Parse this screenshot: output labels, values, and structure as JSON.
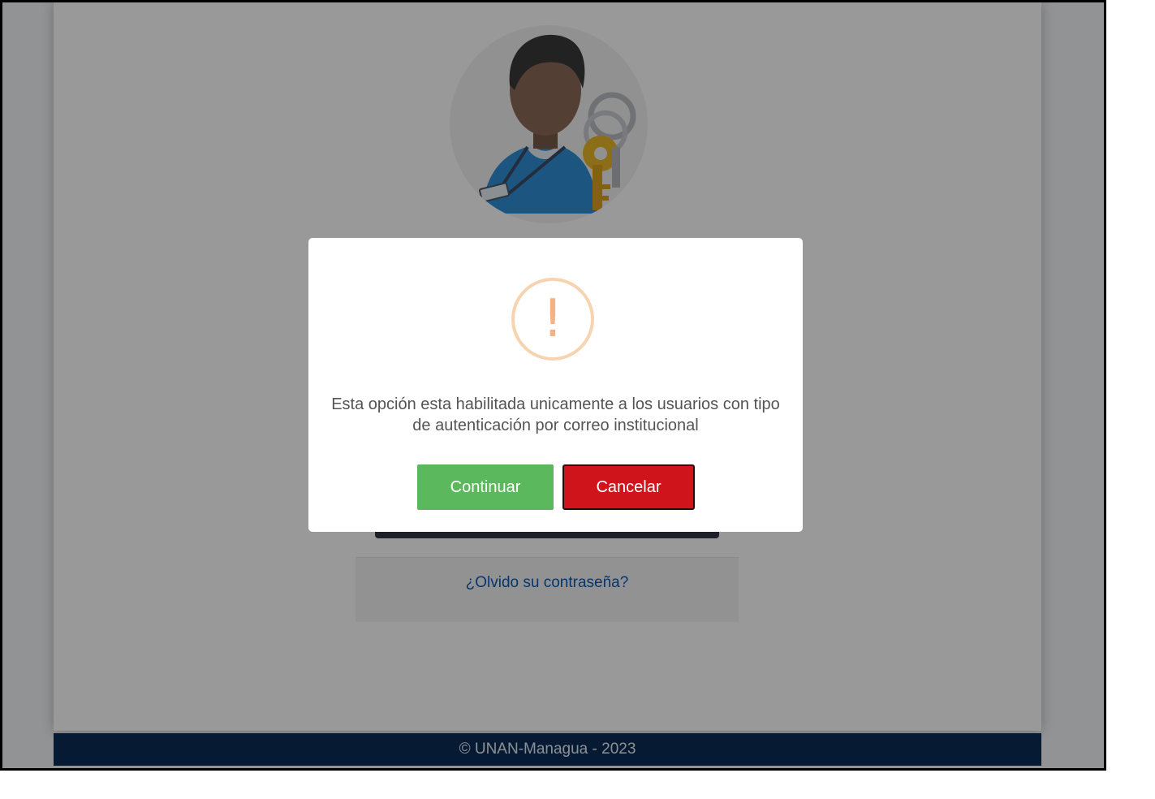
{
  "login_page": {
    "forgot_password_link": "¿Olvido su contraseña?",
    "footer_text": "© UNAN-Managua - 2023"
  },
  "modal": {
    "icon": "warning-exclamation-icon",
    "icon_glyph": "!",
    "message": "Esta opción esta habilitada unicamente a los usuarios con tipo de autenticación por correo institucional",
    "continue_label": "Continuar",
    "cancel_label": "Cancelar"
  },
  "colors": {
    "continue_button": "#5cb85c",
    "cancel_button": "#d0141b",
    "warning_icon": "#f5b384",
    "footer": "#0b2e55",
    "link": "#0d5ab8"
  }
}
